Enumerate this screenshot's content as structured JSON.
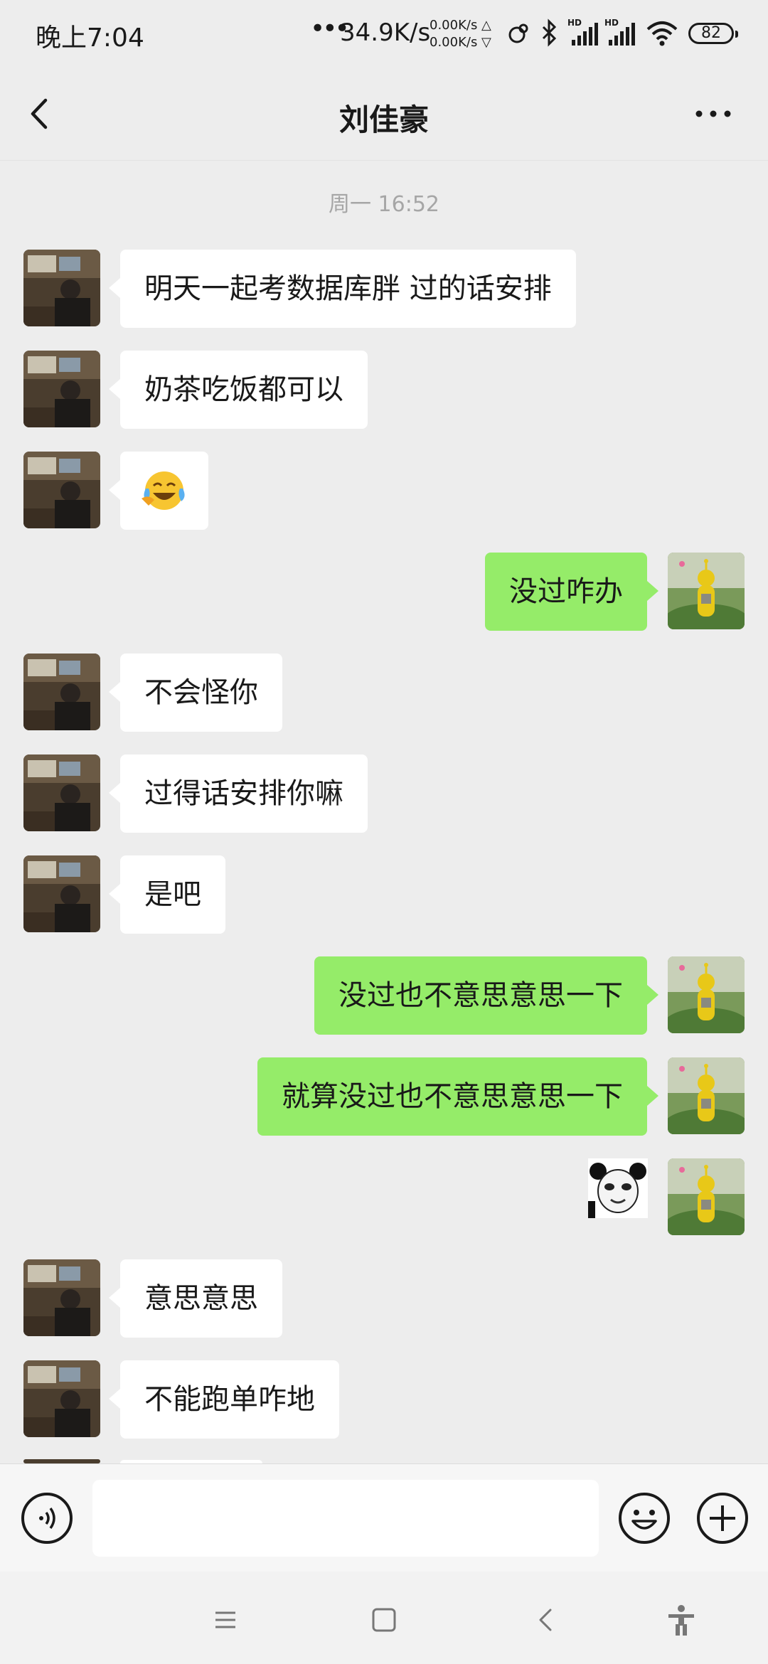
{
  "status_bar": {
    "time": "晚上7:04",
    "dots": "•••",
    "net_speed": "34.9K/s",
    "upload_rate": "0.00K/s △",
    "download_rate": "0.00K/s ▽",
    "battery": "82",
    "icons": [
      "link-icon",
      "bluetooth-icon",
      "hd-signal-icon",
      "hd-signal-icon",
      "wifi-icon",
      "battery-icon"
    ]
  },
  "header": {
    "title": "刘佳豪",
    "back_icon": "chevron-left-icon",
    "more_icon": "more-dots-icon"
  },
  "chat": {
    "timestamp": "周一 16:52",
    "messages": [
      {
        "side": "in",
        "type": "text",
        "text": "明天一起考数据库胖 过的话安排"
      },
      {
        "side": "in",
        "type": "text",
        "text": "奶茶吃饭都可以"
      },
      {
        "side": "in",
        "type": "emoji",
        "emoji": "😂"
      },
      {
        "side": "out",
        "type": "text",
        "text": "没过咋办"
      },
      {
        "side": "in",
        "type": "text",
        "text": "不会怪你"
      },
      {
        "side": "in",
        "type": "text",
        "text": "过得话安排你嘛"
      },
      {
        "side": "in",
        "type": "text",
        "text": "是吧"
      },
      {
        "side": "out",
        "type": "text",
        "text": "没过也不意思意思一下"
      },
      {
        "side": "out",
        "type": "text",
        "text": "就算没过也不意思意思一下"
      },
      {
        "side": "out",
        "type": "sticker",
        "sticker": "panda-face-sticker"
      },
      {
        "side": "in",
        "type": "text",
        "text": "意思意思"
      },
      {
        "side": "in",
        "type": "text",
        "text": "不能跑单咋地"
      }
    ]
  },
  "input_bar": {
    "text_value": "",
    "voice_icon": "voice-icon",
    "emoji_icon": "smiley-icon",
    "plus_icon": "plus-circle-icon"
  },
  "system_nav": [
    "menu-icon",
    "home-square-icon",
    "back-triangle-icon",
    "accessibility-icon"
  ],
  "colors": {
    "background": "#ededed",
    "bubble_in": "#ffffff",
    "bubble_out": "#95ec69",
    "input_bar": "#f6f6f6"
  }
}
